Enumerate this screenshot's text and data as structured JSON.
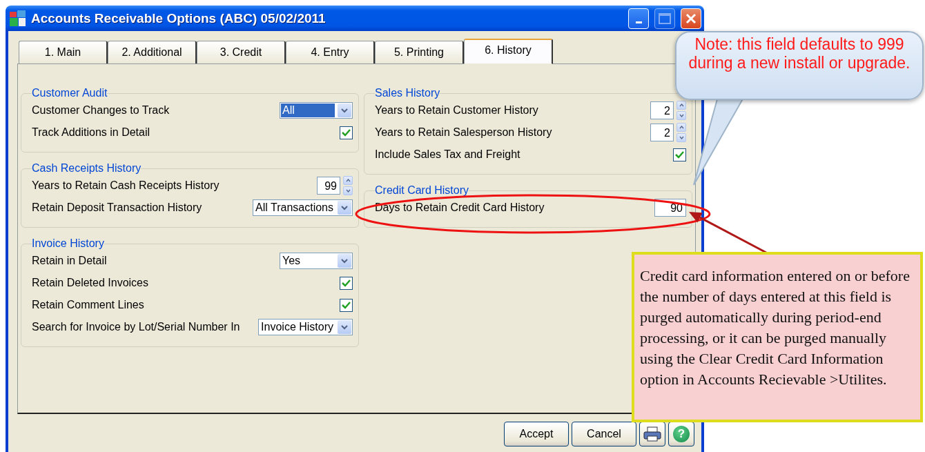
{
  "window": {
    "title": "Accounts Receivable Options (ABC) 05/02/2011",
    "maximize_disabled": true
  },
  "tabs": [
    {
      "label": "1. Main",
      "selected": false
    },
    {
      "label": "2. Additional",
      "selected": false
    },
    {
      "label": "3. Credit",
      "selected": false
    },
    {
      "label": "4. Entry",
      "selected": false
    },
    {
      "label": "5. Printing",
      "selected": false
    },
    {
      "label": "6. History",
      "selected": true
    }
  ],
  "left_column": [
    {
      "title": "Customer Audit",
      "rows": [
        {
          "kind": "dropdown",
          "label": "Customer Changes to Track",
          "value": "All",
          "focused": true
        },
        {
          "kind": "checkbox",
          "label": "Track Additions in Detail",
          "checked": true
        }
      ]
    },
    {
      "title": "Cash Receipts History",
      "rows": [
        {
          "kind": "spinner",
          "label": "Years to Retain Cash Receipts History",
          "value": "99"
        },
        {
          "kind": "dropdown",
          "label": "Retain Deposit Transaction History",
          "value": "All Transactions",
          "focused": false
        }
      ]
    },
    {
      "title": "Invoice History",
      "rows": [
        {
          "kind": "dropdown",
          "label": "Retain in Detail",
          "value": "Yes",
          "focused": false
        },
        {
          "kind": "checkbox",
          "label": "Retain Deleted Invoices",
          "checked": true
        },
        {
          "kind": "checkbox",
          "label": "Retain Comment Lines",
          "checked": true
        },
        {
          "kind": "dropdown",
          "label": "Search for Invoice by Lot/Serial Number In",
          "value": "Invoice History",
          "focused": false
        }
      ]
    }
  ],
  "right_column": [
    {
      "title": "Sales History",
      "rows": [
        {
          "kind": "spinner",
          "label": "Years to Retain Customer History",
          "value": "2"
        },
        {
          "kind": "spinner",
          "label": "Years to Retain Salesperson History",
          "value": "2"
        },
        {
          "kind": "checkbox",
          "label": "Include Sales Tax and Freight",
          "checked": true
        }
      ]
    },
    {
      "title": "Credit Card History",
      "rows": [
        {
          "kind": "number",
          "label": "Days to Retain Credit Card History",
          "value": "90"
        }
      ]
    }
  ],
  "buttons": [
    {
      "kind": "text",
      "label": "Accept"
    },
    {
      "kind": "text",
      "label": "Cancel"
    },
    {
      "kind": "print"
    },
    {
      "kind": "help",
      "label": "?"
    }
  ],
  "callout": {
    "text": "Note: this field defaults to 999 during a new install or upgrade."
  },
  "note": {
    "text": "Credit card information entered on or before the number of days entered at this field is purged automatically during period-end processing, or it can be purged manually using the Clear Credit Card Information option in Accounts Recievable >Utilites."
  }
}
